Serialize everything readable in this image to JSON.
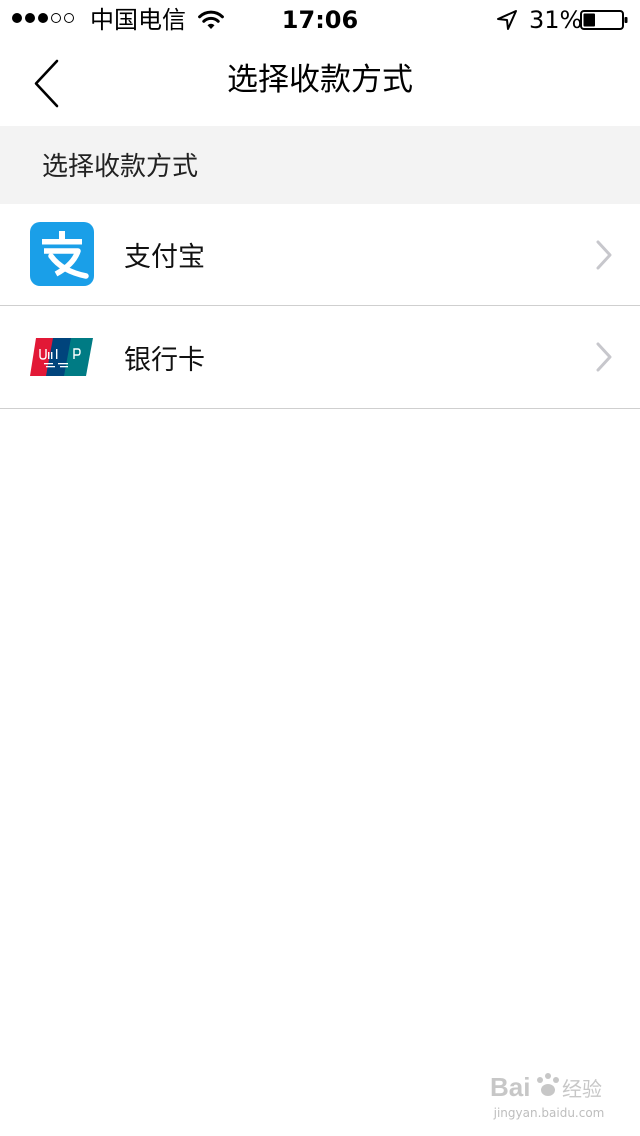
{
  "status_bar": {
    "carrier": "中国电信",
    "time": "17:06",
    "battery": "31%",
    "signal_strength": 3,
    "signal_max": 5,
    "battery_level": 0.31
  },
  "nav": {
    "title": "选择收款方式"
  },
  "section": {
    "header": "选择收款方式"
  },
  "payment_methods": [
    {
      "label": "支付宝",
      "icon": "alipay-icon",
      "color": "#1a9fe8"
    },
    {
      "label": "银行卡",
      "icon": "unionpay-icon",
      "colors": [
        "#e21836",
        "#00447c",
        "#007b84"
      ]
    }
  ],
  "watermark": {
    "text": "Bai 经验",
    "url": "jingyan.baidu.com"
  },
  "colors": {
    "section_bg": "#f3f3f3",
    "divider": "#cfcfcf",
    "chevron": "#c7c7cc"
  }
}
